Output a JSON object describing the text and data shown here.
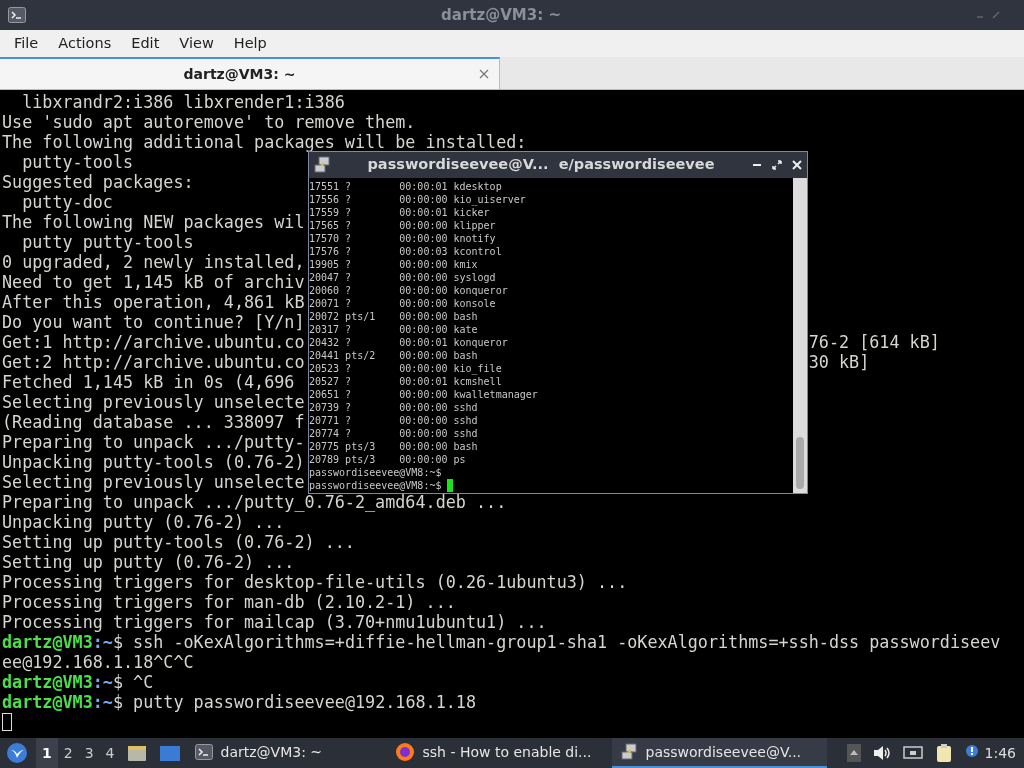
{
  "window": {
    "title": "dartz@VM3: ~"
  },
  "menu": [
    "File",
    "Actions",
    "Edit",
    "View",
    "Help"
  ],
  "tabs": [
    {
      "label": "dartz@VM3: ~",
      "selected": true
    }
  ],
  "terminal": {
    "lines": [
      {
        "kind": "text",
        "text": "  libxrandr2:i386 libxrender1:i386"
      },
      {
        "kind": "text",
        "text": "Use 'sudo apt autoremove' to remove them."
      },
      {
        "kind": "text",
        "text": "The following additional packages will be installed:"
      },
      {
        "kind": "text",
        "text": "  putty-tools"
      },
      {
        "kind": "text",
        "text": "Suggested packages:"
      },
      {
        "kind": "text",
        "text": "  putty-doc"
      },
      {
        "kind": "text",
        "text": "The following NEW packages wil"
      },
      {
        "kind": "text",
        "text": "  putty putty-tools"
      },
      {
        "kind": "text",
        "text": "0 upgraded, 2 newly installed,"
      },
      {
        "kind": "text",
        "text": "Need to get 1,145 kB of archiv"
      },
      {
        "kind": "text",
        "text": "After this operation, 4,861 kB"
      },
      {
        "kind": "text",
        "text": "Do you want to continue? [Y/n]"
      },
      {
        "kind": "text",
        "text": "Get:1 http://archive.ubuntu.co",
        "tail": "76-2 [614 kB]"
      },
      {
        "kind": "text",
        "text": "Get:2 http://archive.ubuntu.co",
        "tail": "30 kB]"
      },
      {
        "kind": "text",
        "text": "Fetched 1,145 kB in 0s (4,696"
      },
      {
        "kind": "text",
        "text": "Selecting previously unselecte"
      },
      {
        "kind": "text",
        "text": "(Reading database ... 338097 f"
      },
      {
        "kind": "text",
        "text": "Preparing to unpack .../putty-"
      },
      {
        "kind": "text",
        "text": "Unpacking putty-tools (0.76-2)"
      },
      {
        "kind": "text",
        "text": "Selecting previously unselecte"
      },
      {
        "kind": "text",
        "text": "Preparing to unpack .../putty_0.76-2_amd64.deb ..."
      },
      {
        "kind": "text",
        "text": "Unpacking putty (0.76-2) ..."
      },
      {
        "kind": "text",
        "text": "Setting up putty-tools (0.76-2) ..."
      },
      {
        "kind": "text",
        "text": "Setting up putty (0.76-2) ..."
      },
      {
        "kind": "text",
        "text": "Processing triggers for desktop-file-utils (0.26-1ubuntu3) ..."
      },
      {
        "kind": "text",
        "text": "Processing triggers for man-db (2.10.2-1) ..."
      },
      {
        "kind": "text",
        "text": "Processing triggers for mailcap (3.70+nmu1ubuntu1) ..."
      },
      {
        "kind": "prompt",
        "user": "dartz@VM3",
        "path": ":~",
        "rest": "$ ssh -oKexAlgorithms=+diffie-hellman-group1-sha1 -oKexAlgorithms=+ssh-dss passwordiseev"
      },
      {
        "kind": "text",
        "text": "ee@192.168.1.18^C^C"
      },
      {
        "kind": "prompt",
        "user": "dartz@VM3",
        "path": ":~",
        "rest": "$ ^C"
      },
      {
        "kind": "prompt",
        "user": "dartz@VM3",
        "path": ":~",
        "rest": "$ putty passwordiseevee@192.168.1.18"
      }
    ]
  },
  "putty": {
    "title": "passwordiseevee@V...  e/passwordiseevee",
    "lines": [
      "17551 ?        00:00:01 kdesktop",
      "17556 ?        00:00:00 kio_uiserver",
      "17559 ?        00:00:01 kicker",
      "17565 ?        00:00:00 klipper",
      "17570 ?        00:00:00 knotify",
      "17576 ?        00:00:03 kcontrol",
      "19905 ?        00:00:00 kmix",
      "20047 ?        00:00:00 syslogd",
      "20060 ?        00:00:00 konqueror",
      "20071 ?        00:00:00 konsole",
      "20072 pts/1    00:00:00 bash",
      "20317 ?        00:00:00 kate",
      "20432 ?        00:00:01 konqueror",
      "20441 pts/2    00:00:00 bash",
      "20523 ?        00:00:00 kio_file",
      "20527 ?        00:00:01 kcmshell",
      "20651 ?        00:00:00 kwalletmanager",
      "20739 ?        00:00:00 sshd",
      "20771 ?        00:00:00 sshd",
      "20774 ?        00:00:00 sshd",
      "20775 pts/3    00:00:00 bash",
      "20789 pts/3    00:00:00 ps",
      "passwordiseevee@VM8:~$",
      "passwordiseevee@VM8:~$"
    ]
  },
  "taskbar": {
    "workspaces": [
      {
        "label": "1",
        "selected": true
      },
      {
        "label": "2",
        "selected": false
      },
      {
        "label": "3",
        "selected": false
      },
      {
        "label": "4",
        "selected": false
      }
    ],
    "tasks": [
      {
        "label": "dartz@VM3: ~",
        "kind": "terminal",
        "selected": false
      },
      {
        "label": "ssh - How to enable di...",
        "kind": "browser",
        "selected": false
      },
      {
        "label": "passwordiseevee@V...",
        "kind": "remote",
        "selected": true
      }
    ],
    "clock": "1:46"
  }
}
